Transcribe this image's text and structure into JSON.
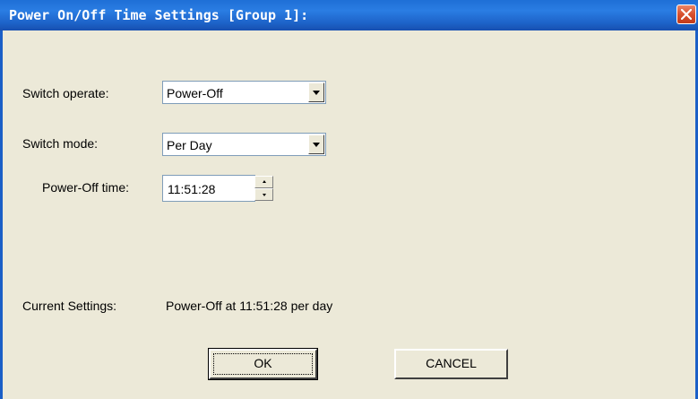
{
  "window": {
    "title": "Power On/Off Time Settings [Group 1]:",
    "close_icon": "close-icon"
  },
  "form": {
    "switch_operate_label": "Switch operate:",
    "switch_operate_value": "Power-Off",
    "switch_mode_label": "Switch  mode:",
    "switch_mode_value": "Per Day",
    "time_label": "Power-Off time:",
    "time_value": "11:51:28"
  },
  "current": {
    "label": "Current Settings:",
    "value": "Power-Off at 11:51:28 per day"
  },
  "buttons": {
    "ok": "OK",
    "cancel": "CANCEL"
  },
  "colors": {
    "dialog_bg": "#ECE9D8",
    "titlebar": "#1E6FD6",
    "close_button": "#D8502E"
  }
}
